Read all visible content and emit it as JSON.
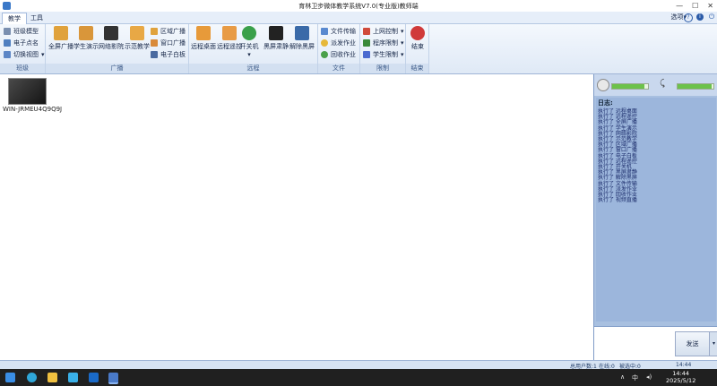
{
  "window": {
    "title": "育林卫步微体教学系统V7.0(专业版)教师端",
    "min_glyph": "—",
    "max_glyph": "☐",
    "close_glyph": "✕"
  },
  "tabs": [
    "教学",
    "工具"
  ],
  "options_label": "选项",
  "options_caret": "▾",
  "top_icons": {
    "help_glyph": "?",
    "info_glyph": "i",
    "power_glyph": "⏻"
  },
  "ribbon": {
    "class_group": {
      "label": "班级",
      "items": [
        {
          "label": "班级模型",
          "icon": "class-model-icon",
          "color": "#7a8fb0"
        },
        {
          "label": "电子点名",
          "icon": "rollcall-icon",
          "color": "#4f7fc0"
        },
        {
          "label": "切换视图",
          "icon": "switch-view-icon",
          "color": "#5c86c6",
          "caret": "▾"
        }
      ]
    },
    "broadcast_group": {
      "label": "广播",
      "big": [
        {
          "label": "全屏广播",
          "icon": "fullscreen-broadcast-icon",
          "color": "#e0a23c"
        },
        {
          "label": "学生演示",
          "icon": "student-demo-icon",
          "color": "#d9963a"
        },
        {
          "label": "网络影院",
          "icon": "network-cinema-icon",
          "color": "#333333"
        },
        {
          "label": "示范教学",
          "icon": "demo-teaching-icon",
          "color": "#e8a845"
        }
      ],
      "small": [
        {
          "label": "区域广播",
          "icon": "area-broadcast-icon",
          "color": "#e0a23c"
        },
        {
          "label": "窗口广播",
          "icon": "window-broadcast-icon",
          "color": "#d98a3a"
        },
        {
          "label": "电子白板",
          "icon": "whiteboard-icon",
          "color": "#4a6aa0"
        }
      ]
    },
    "remote_group": {
      "label": "远程",
      "big": [
        {
          "label": "远程桌面",
          "icon": "remote-desktop-icon",
          "color": "#e79a3a"
        },
        {
          "label": "远程遥控",
          "icon": "remote-control-icon",
          "color": "#e89b45"
        },
        {
          "label": "开关机",
          "icon": "power-switch-icon",
          "color": "#3aa04a",
          "caret": "▾"
        },
        {
          "label": "黑屏肃静",
          "icon": "black-screen-icon",
          "color": "#222222"
        },
        {
          "label": "解除黑屏",
          "icon": "unblack-screen-icon",
          "color": "#3a6aa8"
        }
      ]
    },
    "file_group": {
      "label": "文件",
      "items": [
        {
          "label": "文件传输",
          "icon": "file-transfer-icon",
          "color": "#5a8ad0"
        },
        {
          "label": "派发作业",
          "icon": "assign-homework-icon",
          "color": "#e6b83a"
        },
        {
          "label": "回收作业",
          "icon": "collect-homework-icon",
          "color": "#4aa04a"
        }
      ]
    },
    "limit_group": {
      "label": "限制",
      "items": [
        {
          "label": "上网控制",
          "icon": "internet-control-icon",
          "color": "#d04a3a",
          "caret": "▾"
        },
        {
          "label": "程序限制",
          "icon": "program-limit-icon",
          "color": "#3a8a3a",
          "caret": "▾"
        },
        {
          "label": "学生限制",
          "icon": "student-limit-icon",
          "color": "#4a6ad0",
          "caret": "▾"
        }
      ]
    },
    "end_group": {
      "label": "结束",
      "big": [
        {
          "label": "结束",
          "icon": "end-icon",
          "color": "#d03a3a"
        }
      ]
    }
  },
  "student_computer": {
    "name": "WIN-JRMEU4Q9Q9J"
  },
  "right_panel": {
    "speaker_level": 0.9,
    "mic_level": 0.95,
    "mic_glyph": "⤹",
    "log_title": "日志:",
    "log_lines": [
      "执行了  远程桌面",
      "执行了  远程遥控",
      "执行了  全屏广播",
      "执行了  学生演示",
      "执行了  网络影院",
      "执行了  示范教学",
      "执行了  区域广播",
      "执行了  窗口广播",
      "执行了  电子白板",
      "执行了  远程遥控",
      "执行了  开关机",
      "执行了  黑屏肃静",
      "执行了  解除黑屏",
      "执行了  文件传输",
      "执行了  派发作业",
      "执行了  回收作业",
      "执行了  视频直播"
    ],
    "send_label": "发送",
    "send_caret": "▾"
  },
  "status": {
    "total": "总用户数:1",
    "online": "在线:0",
    "selected": "被选中:0",
    "time": "14:44"
  },
  "taskbar": {
    "time": "14:44",
    "date": "2025/5/12",
    "lang": "中",
    "tray_caret": "∧",
    "tray_glyph": "◂)",
    "icons": [
      {
        "name": "start-icon",
        "color": "#3a8ee6"
      },
      {
        "name": "edge-icon",
        "color": "#2fa6d8"
      },
      {
        "name": "file-explorer-icon",
        "color": "#f0c040"
      },
      {
        "name": "photos-icon",
        "color": "#3ab0e8"
      },
      {
        "name": "outlook-icon",
        "color": "#1a6ac8"
      },
      {
        "name": "teacher-app-icon",
        "color": "#4a7ac8"
      }
    ]
  }
}
